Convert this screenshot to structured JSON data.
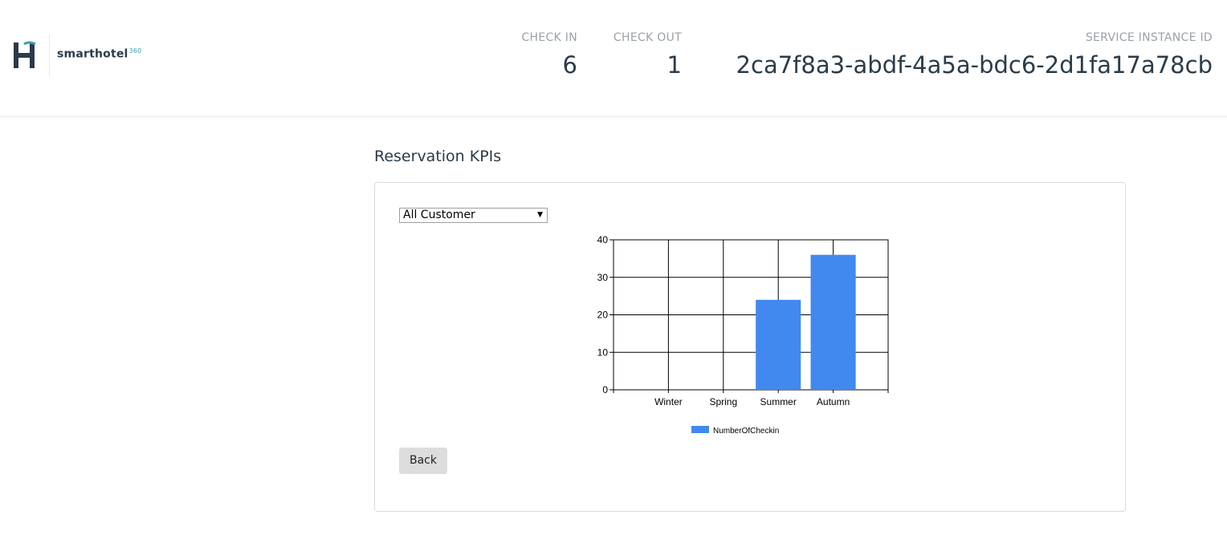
{
  "header": {
    "brand": "smarthotel",
    "brand_sup": "360",
    "check_in": {
      "label": "CHECK IN",
      "value": "6"
    },
    "check_out": {
      "label": "CHECK OUT",
      "value": "1"
    },
    "service_instance": {
      "label": "SERVICE INSTANCE ID",
      "value": "2ca7f8a3-abdf-4a5a-bdc6-2d1fa17a78cb"
    }
  },
  "main": {
    "title": "Reservation KPIs",
    "customer_select": {
      "value": "All Customer"
    },
    "back_label": "Back"
  },
  "colors": {
    "bar": "#4189ee",
    "text": "#2b3b4a",
    "accent": "#3aa0a8"
  },
  "chart_data": {
    "type": "bar",
    "categories": [
      "Winter",
      "Spring",
      "Summer",
      "Autumn"
    ],
    "series": [
      {
        "name": "NumberOfCheckin",
        "values": [
          0,
          0,
          24,
          36
        ]
      }
    ],
    "ylim": [
      0,
      40
    ],
    "yticks": [
      0,
      10,
      20,
      30,
      40
    ],
    "grid": true,
    "legend": "bottom"
  }
}
